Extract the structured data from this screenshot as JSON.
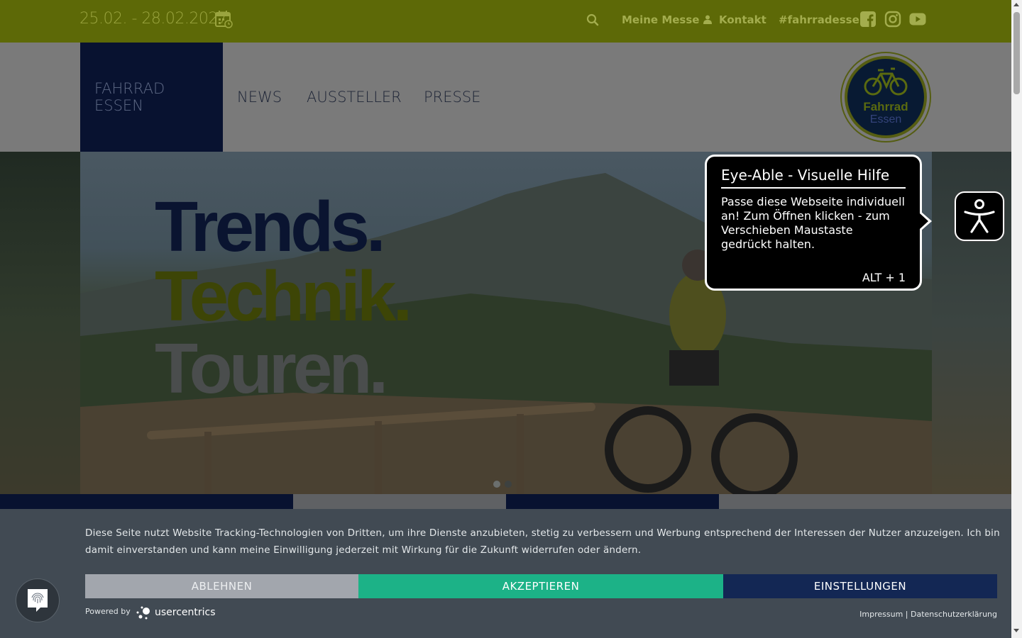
{
  "topbar": {
    "date": "25.02. - 28.02.2027",
    "meine_messe": "Meine Messe",
    "kontakt": "Kontakt",
    "hashtag": "#fahrradessen"
  },
  "menu": {
    "items": [
      {
        "label": "FAHRRAD ESSEN"
      },
      {
        "label": "NEWS"
      },
      {
        "label": "AUSSTELLER"
      },
      {
        "label": "PRESSE"
      }
    ]
  },
  "logo": {
    "line1": "Fahrrad",
    "line2": "Essen"
  },
  "hero": {
    "line1": "Trends.",
    "line2": "Technik.",
    "line3": "Touren."
  },
  "eyeable": {
    "title": "Eye-Able - Visuelle Hilfe",
    "body": "Passe diese Webseite individuell an! Zum Öffnen klicken - zum Verschieben Maustaste gedrückt halten.",
    "shortcut": "ALT + 1"
  },
  "cookie": {
    "text": "Diese Seite nutzt Website Tracking-Technologien von Dritten, um ihre Dienste anzubieten, stetig zu verbessern und Werbung entsprechend der Interessen der Nutzer anzuzeigen. Ich bin damit einverstanden und kann meine Einwilligung jederzeit mit Wirkung für die Zukunft widerrufen oder ändern.",
    "decline": "ABLEHNEN",
    "accept": "AKZEPTIEREN",
    "settings": "EINSTELLUNGEN",
    "powered_by": "Powered by",
    "brand": "usercentrics",
    "impressum": "Impressum",
    "separator": "|",
    "datenschutz": "Datenschutzerklärung"
  },
  "colors": {
    "topbar": "#5d6907",
    "nav_active": "#081230",
    "accept": "#1cb287",
    "decline": "#a2a6ad",
    "settings": "#132754"
  }
}
